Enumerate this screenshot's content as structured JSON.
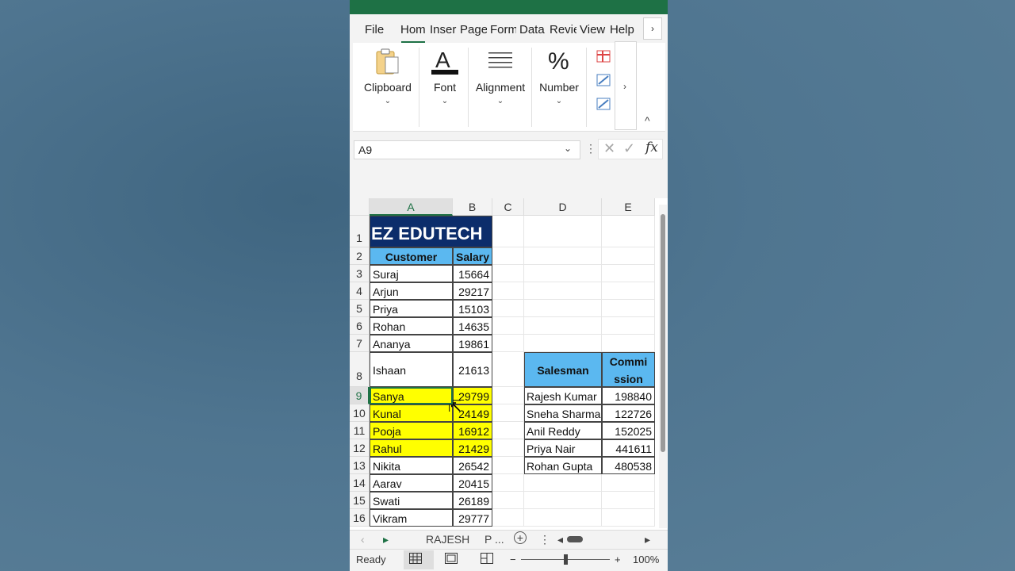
{
  "ribbon_tabs": [
    {
      "label": "File"
    },
    {
      "label": "Hom"
    },
    {
      "label": "Inser"
    },
    {
      "label": "Page"
    },
    {
      "label": "Form"
    },
    {
      "label": "Data"
    },
    {
      "label": "Revie"
    },
    {
      "label": "View"
    },
    {
      "label": "Help"
    }
  ],
  "ribbon_more": "›",
  "ribbon_groups": {
    "clipboard": "Clipboard",
    "font": "Font",
    "alignment": "Alignment",
    "number": "Number",
    "chevron": "⌄",
    "scroll_right": "›",
    "collapse": "^"
  },
  "formula_bar": {
    "name_box": "A9",
    "cancel": "✕",
    "enter": "✓",
    "fx": "fx"
  },
  "columns": [
    "A",
    "B",
    "C",
    "D",
    "E"
  ],
  "rows": [
    "1",
    "2",
    "3",
    "4",
    "5",
    "6",
    "7",
    "8",
    "9",
    "10",
    "11",
    "12",
    "13",
    "14",
    "15",
    "16"
  ],
  "sheet": {
    "title": "EZ EDUTECH",
    "headers": {
      "customer": "Customer",
      "salary": "Salary"
    },
    "customers": [
      {
        "name": "Suraj",
        "salary": "15664"
      },
      {
        "name": "Arjun",
        "salary": "29217"
      },
      {
        "name": "Priya",
        "salary": "15103"
      },
      {
        "name": "Rohan",
        "salary": "14635"
      },
      {
        "name": "Ananya",
        "salary": "19861"
      },
      {
        "name": "Ishaan",
        "salary": "21613"
      },
      {
        "name": "Sanya",
        "salary": "29799"
      },
      {
        "name": "Kunal",
        "salary": "24149"
      },
      {
        "name": "Pooja",
        "salary": "16912"
      },
      {
        "name": "Rahul",
        "salary": "21429"
      },
      {
        "name": "Nikita",
        "salary": "26542"
      },
      {
        "name": "Aarav",
        "salary": "20415"
      },
      {
        "name": "Swati",
        "salary": "26189"
      },
      {
        "name": "Vikram",
        "salary": "29777"
      }
    ],
    "commission_headers": {
      "salesman": "Salesman",
      "commission_1": "Commi",
      "commission_2": "ssion"
    },
    "commissions": [
      {
        "name": "Rajesh Kumar",
        "amount": "198840"
      },
      {
        "name": "Sneha Sharma",
        "amount": "122726"
      },
      {
        "name": "Anil Reddy",
        "amount": "152025"
      },
      {
        "name": "Priya Nair",
        "amount": "441611"
      },
      {
        "name": "Rohan Gupta",
        "amount": "480538"
      }
    ]
  },
  "sheet_tabs": {
    "prev": "‹",
    "next": "▸",
    "tab1": "RAJESH",
    "tab2": "P ...",
    "add": "+",
    "menu": "⋮",
    "scroll_left": "◂",
    "scroll_right": "▸"
  },
  "status": {
    "ready": "Ready",
    "zoom_minus": "−",
    "zoom_plus": "+",
    "zoom": "100%"
  },
  "colors": {
    "header_fill": "#5bb8f0",
    "highlight": "#ffff00",
    "brand": "#0c2d6b",
    "excel_green": "#1e7145"
  }
}
